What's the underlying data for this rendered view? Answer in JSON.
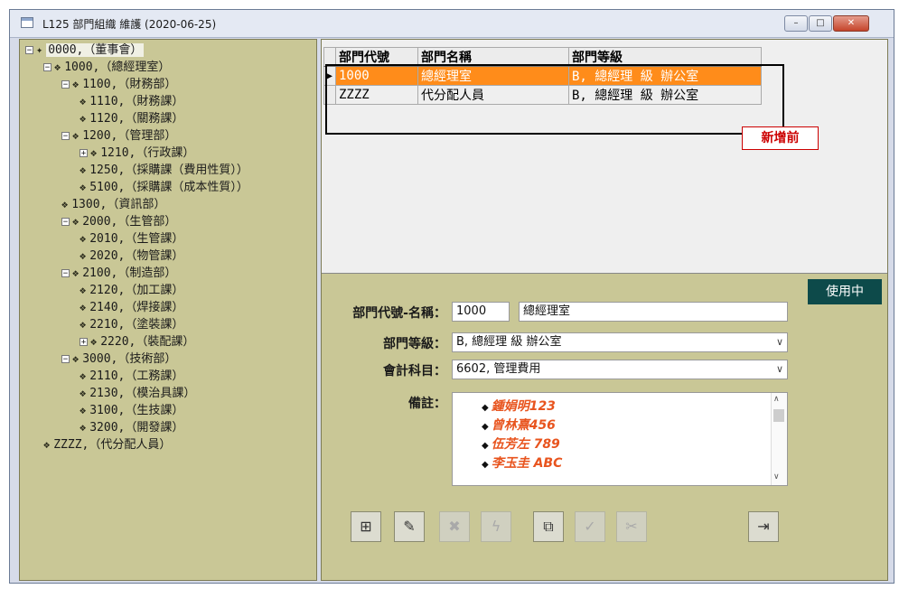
{
  "window": {
    "title": "L125 部門組織 維護 (2020-06-25)",
    "min_glyph": "–",
    "max_glyph": "□",
    "close_glyph": "✕"
  },
  "tree": {
    "root": "0000,（董事會）",
    "nodes": [
      "1000,（總經理室）",
      "1100,（財務部）",
      "1110,（財務課）",
      "1120,（關務課）",
      "1200,（管理部）",
      "1210,（行政課）",
      "1250,（採購課（費用性質））",
      "5100,（採購課（成本性質））",
      "1300,（資訊部）",
      "2000,（生管部）",
      "2010,（生管課）",
      "2020,（物管課）",
      "2100,（制造部）",
      "2120,（加工課）",
      "2140,（焊接課）",
      "2210,（塗裝課）",
      "2220,（裝配課）",
      "3000,（技術部）",
      "2110,（工務課）",
      "2130,（模治具課）",
      "3100,（生技課）",
      "3200,（開發課）",
      "ZZZZ,（代分配人員）"
    ]
  },
  "grid": {
    "headers": [
      "部門代號",
      "部門名稱",
      "部門等級"
    ],
    "rows": [
      {
        "code": "1000",
        "name": "總經理室",
        "level": "B, 總經理 級 辦公室"
      },
      {
        "code": "ZZZZ",
        "name": "代分配人員",
        "level": "B, 總經理 級 辦公室"
      }
    ],
    "current_row_marker": "▶"
  },
  "annotation": {
    "label": "新增前"
  },
  "status": "使用中",
  "form": {
    "code_name_label": "部門代號-名稱：",
    "code": "1000",
    "name": "總經理室",
    "level_label": "部門等級：",
    "level_value": "B, 總經理 級 辦公室",
    "account_label": "會計科目：",
    "account_value": "6602, 管理費用",
    "memo_label": "備註：",
    "memo_lines": [
      "鍾娟明123",
      "曾林熹456",
      "伍芳左 789",
      "李玉圭 ABC"
    ],
    "memo_bullet": "◆",
    "dropdown_glyph": "∨"
  },
  "toolbar": {
    "icons": [
      "add-record-icon",
      "edit-record-icon",
      "delete-record-icon",
      "query-icon",
      "copy-record-icon",
      "confirm-icon",
      "cancel-icon",
      "exit-icon"
    ],
    "glyphs": {
      "add": "⊞",
      "edit": "✎",
      "delete": "✖",
      "query": "ϟ",
      "copy": "⧉",
      "confirm": "✓",
      "cancel": "✂",
      "exit": "⇥"
    }
  },
  "colors": {
    "panel_bg": "#c9c796",
    "selected_row": "#ff8c1a",
    "status_badge": "#0d4a4a",
    "memo_text": "#e8541e",
    "annotation": "#cc0000"
  }
}
